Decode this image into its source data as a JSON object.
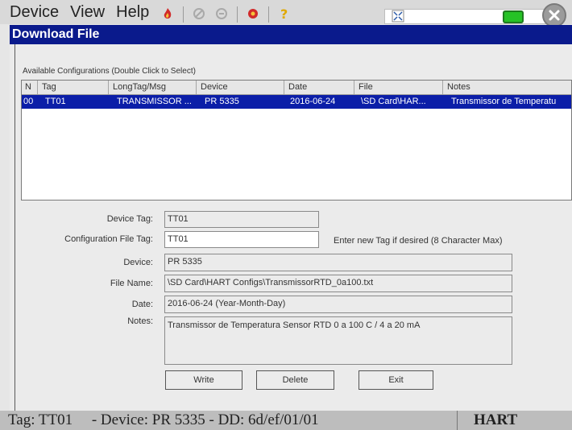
{
  "menu": {
    "device": "Device",
    "view": "View",
    "help": "Help"
  },
  "toolbar_icons": [
    "fire-icon",
    "disabled-tool-icon",
    "disabled-tool-icon",
    "red-tool-icon",
    "help-question-icon"
  ],
  "window": {
    "title": "Download File"
  },
  "configs": {
    "label": "Available Configurations (Double Click to Select)",
    "columns": [
      "N",
      "Tag",
      "LongTag/Msg",
      "Device",
      "Date",
      "File",
      "Notes"
    ],
    "rows": [
      {
        "n": "00",
        "tag": "TT01",
        "longtag": "TRANSMISSOR ...",
        "device": "PR 5335",
        "date": "2016-06-24",
        "file": "\\SD Card\\HAR...",
        "notes": "Transmissor de Temperatu"
      }
    ]
  },
  "form": {
    "device_tag_label": "Device Tag:",
    "device_tag_value": "TT01",
    "config_tag_label": "Configuration File Tag:",
    "config_tag_value": "TT01",
    "config_tag_hint": "Enter new Tag if desired (8 Character Max)",
    "device_label": "Device:",
    "device_value": "PR 5335",
    "filename_label": "File Name:",
    "filename_value": "\\SD Card\\HART Configs\\TransmissorRTD_0a100.txt",
    "date_label": "Date:",
    "date_value": "2016-06-24 (Year-Month-Day)",
    "notes_label": "Notes:",
    "notes_value": "Transmissor de Temperatura Sensor RTD 0 a 100 C / 4 a 20 mA"
  },
  "buttons": {
    "write": "Write",
    "delete": "Delete",
    "exit": "Exit"
  },
  "status": {
    "text": "Tag: TT01     - Device: PR 5335 - DD: 6d/ef/01/01",
    "protocol": "HART"
  },
  "colors": {
    "title_bar": "#0a1a8c",
    "selection": "#0b1ea8",
    "battery": "#26c226"
  }
}
